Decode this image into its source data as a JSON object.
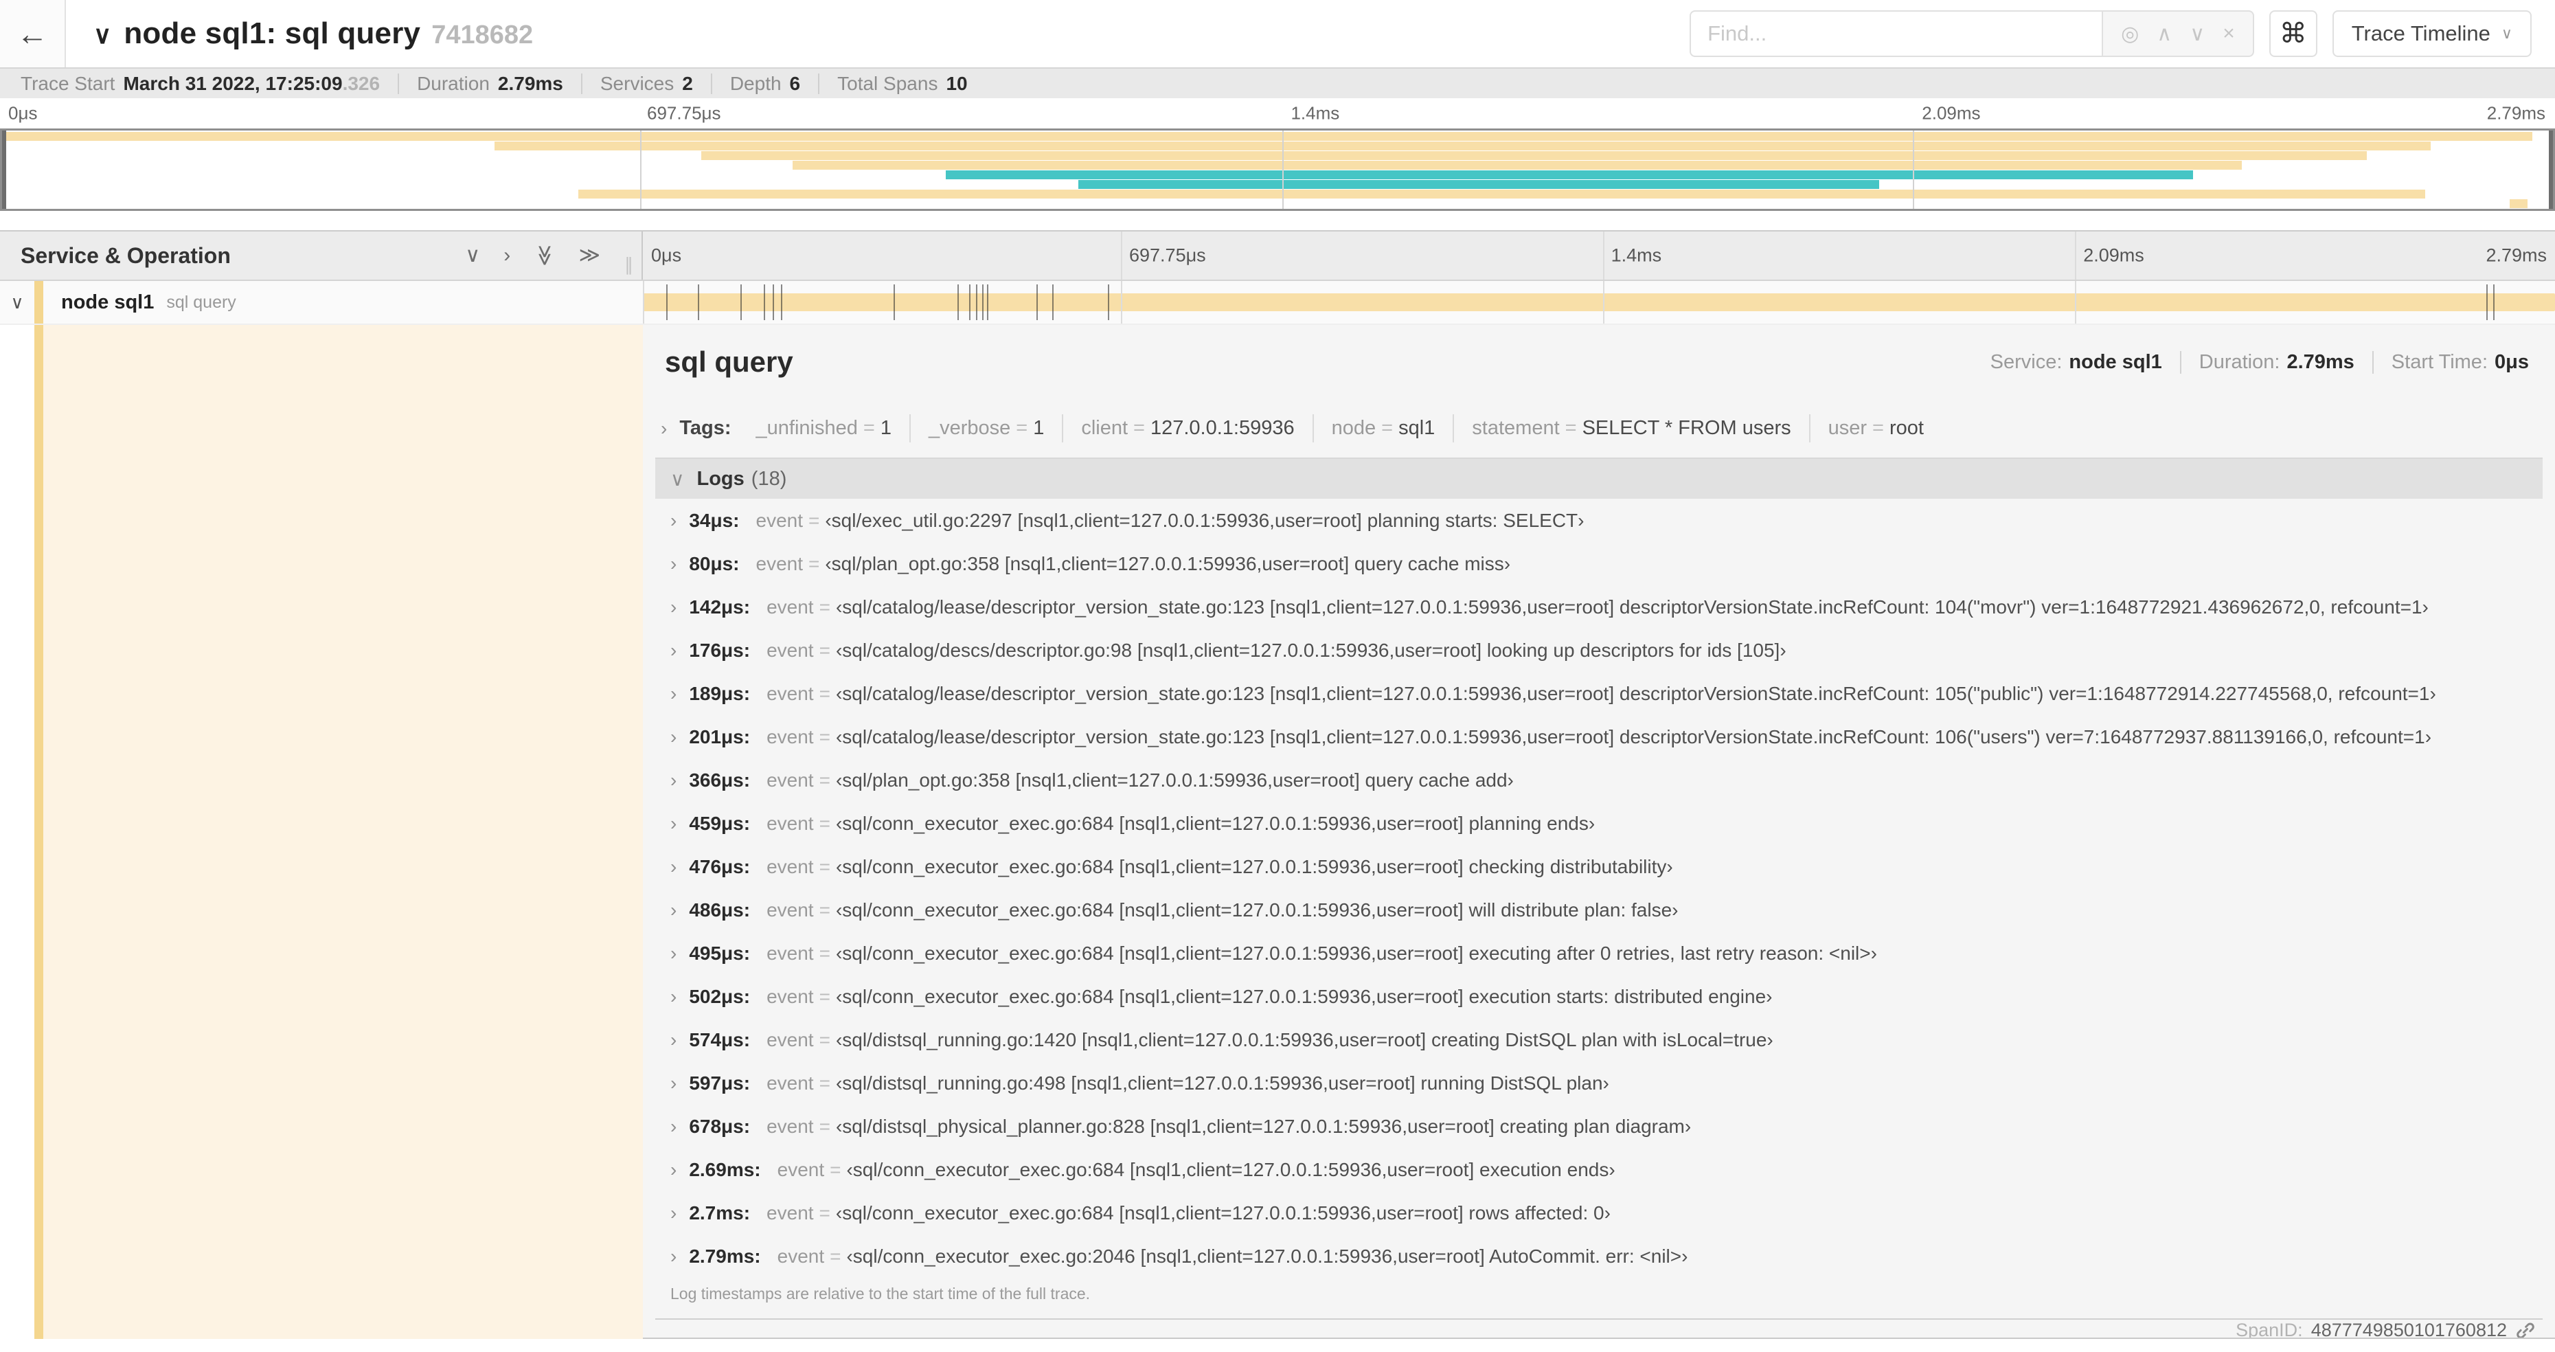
{
  "colors": {
    "span_tan": "#f8dfa8",
    "span_teal": "#45c5c5",
    "detail_cream": "#fdf3e3",
    "detail_stripe": "#f4d68e"
  },
  "icons": {
    "back": "←",
    "collapse_chevron": "∨",
    "chevron_right": "›",
    "chevron_down": "∨",
    "crosshair": "◎",
    "prev": "∧",
    "next": "∨",
    "clear": "×",
    "command": "⌘",
    "double_right": "≫",
    "grip": "∥"
  },
  "header": {
    "title": "node sql1: sql query",
    "trace_id": "7418682",
    "find_placeholder": "Find...",
    "view_selector": "Trace Timeline"
  },
  "stats": {
    "items": [
      {
        "label": "Trace Start",
        "value": "March 31 2022, 17:25:09",
        "suffix": ".326"
      },
      {
        "label": "Duration",
        "value": "2.79ms",
        "suffix": ""
      },
      {
        "label": "Services",
        "value": "2",
        "suffix": ""
      },
      {
        "label": "Depth",
        "value": "6",
        "suffix": ""
      },
      {
        "label": "Total Spans",
        "value": "10",
        "suffix": ""
      }
    ]
  },
  "timeline": {
    "duration_us": 2790,
    "ticks": [
      {
        "label": "0μs",
        "pct": 0,
        "align": "left"
      },
      {
        "label": "697.75μs",
        "pct": 25,
        "align": "left"
      },
      {
        "label": "1.4ms",
        "pct": 50.2,
        "align": "left"
      },
      {
        "label": "2.09ms",
        "pct": 74.9,
        "align": "left"
      },
      {
        "label": "2.79ms",
        "pct": 100,
        "align": "right"
      }
    ],
    "gridlines_pct": [
      25,
      50.2,
      74.9
    ],
    "service_operation_label": "Service & Operation"
  },
  "minimap": {
    "spans": [
      {
        "l": 0,
        "w": 99.2,
        "c": "tan"
      },
      {
        "l": 19.3,
        "w": 75.9,
        "c": "tan"
      },
      {
        "l": 27.4,
        "w": 65.3,
        "c": "tan"
      },
      {
        "l": 31.0,
        "w": 56.8,
        "c": "tan"
      },
      {
        "l": 37.0,
        "w": 48.9,
        "c": "teal"
      },
      {
        "l": 42.2,
        "w": 31.4,
        "c": "teal"
      },
      {
        "l": 22.6,
        "w": 72.4,
        "c": "tan"
      },
      {
        "l": 98.3,
        "w": 0.7,
        "c": "tan"
      }
    ]
  },
  "span_row": {
    "service": "node sql1",
    "operation": "sql query",
    "bar_left_pct": 0,
    "bar_width_pct": 100
  },
  "shared": {
    "eq": "="
  },
  "detail": {
    "title": "sql query",
    "meta": [
      {
        "label": "Service:",
        "value": "node sql1"
      },
      {
        "label": "Duration:",
        "value": "2.79ms"
      },
      {
        "label": "Start Time:",
        "value": "0μs"
      }
    ],
    "tags_label": "Tags:",
    "tags": [
      {
        "key": "_unfinished",
        "value": "1"
      },
      {
        "key": "_verbose",
        "value": "1"
      },
      {
        "key": "client",
        "value": "127.0.0.1:59936"
      },
      {
        "key": "node",
        "value": "sql1"
      },
      {
        "key": "statement",
        "value": "SELECT * FROM users"
      },
      {
        "key": "user",
        "value": "root"
      }
    ],
    "logs_title": "Logs",
    "logs_count": "(18)",
    "log_key": "event",
    "logs": [
      {
        "t": "34μs",
        "us": 34,
        "v": "‹sql/exec_util.go:2297 [nsql1,client=127.0.0.1:59936,user=root] planning starts: SELECT›"
      },
      {
        "t": "80μs",
        "us": 80,
        "v": "‹sql/plan_opt.go:358 [nsql1,client=127.0.0.1:59936,user=root] query cache miss›"
      },
      {
        "t": "142μs",
        "us": 142,
        "v": "‹sql/catalog/lease/descriptor_version_state.go:123 [nsql1,client=127.0.0.1:59936,user=root] descriptorVersionState.incRefCount: 104(\"movr\") ver=1:1648772921.436962672,0, refcount=1›"
      },
      {
        "t": "176μs",
        "us": 176,
        "v": "‹sql/catalog/descs/descriptor.go:98 [nsql1,client=127.0.0.1:59936,user=root] looking up descriptors for ids [105]›"
      },
      {
        "t": "189μs",
        "us": 189,
        "v": "‹sql/catalog/lease/descriptor_version_state.go:123 [nsql1,client=127.0.0.1:59936,user=root] descriptorVersionState.incRefCount: 105(\"public\") ver=1:1648772914.227745568,0, refcount=1›"
      },
      {
        "t": "201μs",
        "us": 201,
        "v": "‹sql/catalog/lease/descriptor_version_state.go:123 [nsql1,client=127.0.0.1:59936,user=root] descriptorVersionState.incRefCount: 106(\"users\") ver=7:1648772937.881139166,0, refcount=1›"
      },
      {
        "t": "366μs",
        "us": 366,
        "v": "‹sql/plan_opt.go:358 [nsql1,client=127.0.0.1:59936,user=root] query cache add›"
      },
      {
        "t": "459μs",
        "us": 459,
        "v": "‹sql/conn_executor_exec.go:684 [nsql1,client=127.0.0.1:59936,user=root] planning ends›"
      },
      {
        "t": "476μs",
        "us": 476,
        "v": "‹sql/conn_executor_exec.go:684 [nsql1,client=127.0.0.1:59936,user=root] checking distributability›"
      },
      {
        "t": "486μs",
        "us": 486,
        "v": "‹sql/conn_executor_exec.go:684 [nsql1,client=127.0.0.1:59936,user=root] will distribute plan: false›"
      },
      {
        "t": "495μs",
        "us": 495,
        "v": "‹sql/conn_executor_exec.go:684 [nsql1,client=127.0.0.1:59936,user=root] executing after 0 retries, last retry reason: <nil>›"
      },
      {
        "t": "502μs",
        "us": 502,
        "v": "‹sql/conn_executor_exec.go:684 [nsql1,client=127.0.0.1:59936,user=root] execution starts: distributed engine›"
      },
      {
        "t": "574μs",
        "us": 574,
        "v": "‹sql/distsql_running.go:1420 [nsql1,client=127.0.0.1:59936,user=root] creating DistSQL plan with isLocal=true›"
      },
      {
        "t": "597μs",
        "us": 597,
        "v": "‹sql/distsql_running.go:498 [nsql1,client=127.0.0.1:59936,user=root] running DistSQL plan›"
      },
      {
        "t": "678μs",
        "us": 678,
        "v": "‹sql/distsql_physical_planner.go:828 [nsql1,client=127.0.0.1:59936,user=root] creating plan diagram›"
      },
      {
        "t": "2.69ms",
        "us": 2690,
        "v": "‹sql/conn_executor_exec.go:684 [nsql1,client=127.0.0.1:59936,user=root] execution ends›"
      },
      {
        "t": "2.7ms",
        "us": 2700,
        "v": "‹sql/conn_executor_exec.go:684 [nsql1,client=127.0.0.1:59936,user=root] rows affected: 0›"
      },
      {
        "t": "2.79ms",
        "us": 2790,
        "v": "‹sql/conn_executor_exec.go:2046 [nsql1,client=127.0.0.1:59936,user=root] AutoCommit. err: <nil>›"
      }
    ],
    "logs_note": "Log timestamps are relative to the start time of the full trace.",
    "spanid_label": "SpanID:",
    "spanid": "4877749850101760812"
  }
}
